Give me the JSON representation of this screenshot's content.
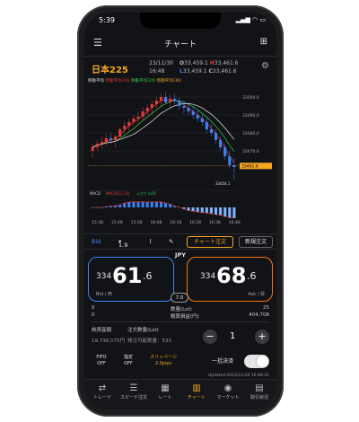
{
  "status": {
    "time": "5:39",
    "icons": "▂▄▆ ◠ ▭"
  },
  "nav": {
    "title": "チャート",
    "menu_icon": "hamburger-icon",
    "grid_icon": "grid-icon"
  },
  "instrument": {
    "name": "日本225",
    "date": "23/11/30",
    "time": "16:48",
    "o_label": "O",
    "o_value": "33,459.1",
    "h_label": "H",
    "h_value": "33,461.6",
    "l_label": "L",
    "l_value": "33,459.1",
    "c_label": "C",
    "c_value": "33,461.6"
  },
  "indicators": {
    "ma1": "移動平均",
    "ma2": "移動平均(10)",
    "ma3": "移動平均(20)",
    "ma4": "移動平均(30)"
  },
  "macd_legend": {
    "label": "MACD",
    "v1": "MACD(12,26)",
    "v2": "シグナル(9)"
  },
  "chart_data": {
    "type": "candlestick",
    "y_ticks": [
      "33500.0",
      "33490.0",
      "33480.0",
      "33470.0"
    ],
    "last_price": "33461.6",
    "low_label": "33454.1",
    "x_ticks": [
      "15:38",
      "15:48",
      "15:58",
      "16:08",
      "16:18",
      "16:28",
      "16:38",
      "16:48"
    ],
    "candles": [
      [
        33470,
        33474,
        33466,
        33472
      ],
      [
        33472,
        33476,
        33470,
        33474
      ],
      [
        33474,
        33478,
        33471,
        33475
      ],
      [
        33475,
        33479,
        33473,
        33477
      ],
      [
        33477,
        33480,
        33474,
        33476
      ],
      [
        33476,
        33479,
        33472,
        33478
      ],
      [
        33478,
        33483,
        33476,
        33482
      ],
      [
        33482,
        33486,
        33480,
        33484
      ],
      [
        33484,
        33488,
        33481,
        33486
      ],
      [
        33486,
        33490,
        33484,
        33488
      ],
      [
        33488,
        33492,
        33485,
        33489
      ],
      [
        33489,
        33494,
        33487,
        33492
      ],
      [
        33492,
        33496,
        33490,
        33494
      ],
      [
        33494,
        33498,
        33491,
        33496
      ],
      [
        33496,
        33500,
        33494,
        33498
      ],
      [
        33498,
        33502,
        33495,
        33500
      ],
      [
        33500,
        33503,
        33496,
        33497
      ],
      [
        33497,
        33501,
        33494,
        33499
      ],
      [
        33499,
        33502,
        33496,
        33498
      ],
      [
        33498,
        33500,
        33493,
        33495
      ],
      [
        33495,
        33498,
        33491,
        33494
      ],
      [
        33494,
        33497,
        33490,
        33492
      ],
      [
        33492,
        33495,
        33488,
        33490
      ],
      [
        33490,
        33493,
        33486,
        33488
      ],
      [
        33488,
        33491,
        33484,
        33486
      ],
      [
        33486,
        33488,
        33480,
        33482
      ],
      [
        33482,
        33485,
        33478,
        33480
      ],
      [
        33480,
        33482,
        33474,
        33476
      ],
      [
        33476,
        33478,
        33470,
        33472
      ],
      [
        33472,
        33474,
        33465,
        33467
      ],
      [
        33467,
        33470,
        33460,
        33462
      ],
      [
        33462,
        33466,
        33454,
        33461
      ]
    ],
    "ylim": [
      33450,
      33506
    ]
  },
  "trade_bar": {
    "bid_label": "Bid",
    "lot_label": "1.9",
    "chart_order": "チャート注文",
    "new_order": "新規注文"
  },
  "quote": {
    "currency": "JPY",
    "bid_prefix": "334",
    "bid_big": "61",
    "bid_dec": ".6",
    "bid_label": "Bid / 売",
    "ask_prefix": "334",
    "ask_big": "68",
    "ask_dec": ".6",
    "ask_label": "Ask / 買",
    "spread": "7.0"
  },
  "rows": [
    {
      "left": "0",
      "mid": "数量(Lot)",
      "right": "25"
    },
    {
      "left": "0",
      "mid": "概算損益(円)",
      "right": "404,708"
    }
  ],
  "qty": {
    "margin_label": "純資産額",
    "margin_value": "19,736,575円",
    "order_label": "注文数量(Lot)",
    "available": "発注可能数量：533",
    "value": "1",
    "minus": "−",
    "plus": "+"
  },
  "options": {
    "fifo": "FIFO",
    "fifo_state": "OFF",
    "limit": "指定",
    "limit_state": "OFF",
    "slippage": "スリッページ",
    "slippage_value": "2.0pips",
    "settle_all": "一括決済"
  },
  "updated": "Updated 2023/11/30 16:48:21",
  "tabs": [
    {
      "label": "トレード",
      "icon": "trade-icon",
      "glyph": "⇄"
    },
    {
      "label": "スピード注文",
      "icon": "speed-order-icon",
      "glyph": "☰"
    },
    {
      "label": "レート",
      "icon": "rate-icon",
      "glyph": "▦"
    },
    {
      "label": "チャート",
      "icon": "chart-icon",
      "glyph": "▥"
    },
    {
      "label": "マーケット",
      "icon": "market-icon",
      "glyph": "◉"
    },
    {
      "label": "取引状況",
      "icon": "status-icon",
      "glyph": "▤"
    }
  ],
  "colors": {
    "up": "#e23b3b",
    "down": "#3b82f6",
    "accent": "#f5a623",
    "ma_short": "#e23b3b",
    "ma_mid": "#37c84f",
    "ma_long": "#e6e6e6"
  }
}
